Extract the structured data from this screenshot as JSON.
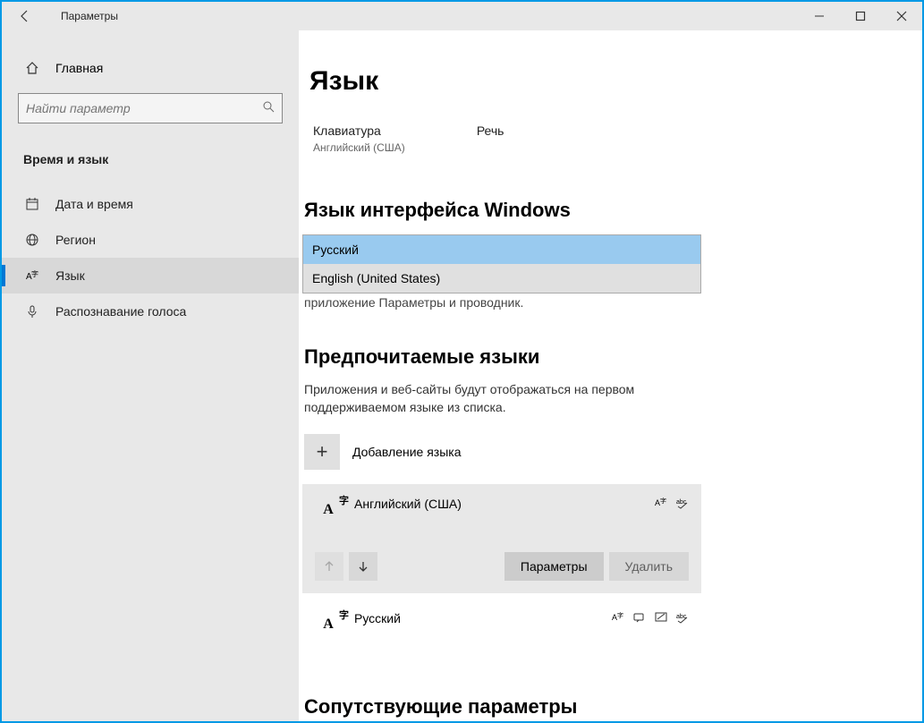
{
  "titlebar": {
    "title": "Параметры"
  },
  "sidebar": {
    "home": "Главная",
    "search_placeholder": "Найти параметр",
    "category": "Время и язык",
    "items": [
      {
        "label": "Дата и время"
      },
      {
        "label": "Регион"
      },
      {
        "label": "Язык"
      },
      {
        "label": "Распознавание голоса"
      }
    ]
  },
  "main": {
    "title": "Язык",
    "keyboard_label": "Клавиатура",
    "keyboard_value": "Английский (США)",
    "speech_label": "Речь",
    "display_lang_heading": "Язык интерфейса Windows",
    "dropdown": {
      "options": [
        "Русский",
        "English (United States)"
      ],
      "selected": "Русский"
    },
    "truncated_text": "приложение  Параметры  и проводник.",
    "preferred_heading": "Предпочитаемые языки",
    "preferred_desc": "Приложения и веб-сайты будут отображаться на первом поддерживаемом языке из списка.",
    "add_language": "Добавление языка",
    "languages": [
      {
        "name": "Английский (США)"
      },
      {
        "name": "Русский"
      }
    ],
    "options_btn": "Параметры",
    "delete_btn": "Удалить",
    "related_heading": "Сопутствующие параметры"
  }
}
